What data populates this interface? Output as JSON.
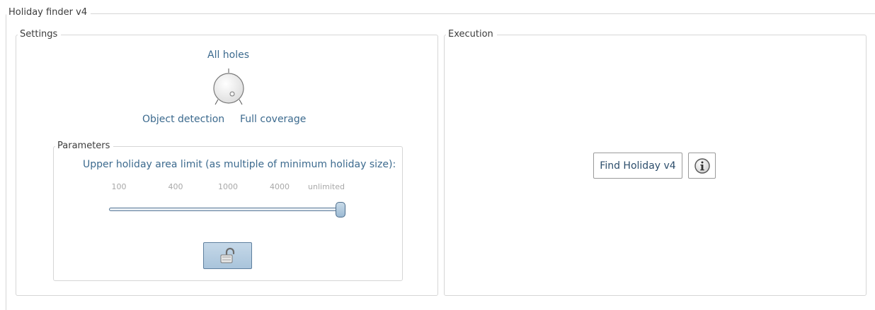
{
  "window": {
    "title": "Holiday finder v4"
  },
  "settings": {
    "legend": "Settings",
    "mode_knob": {
      "top_label": "All holes",
      "left_label": "Object detection",
      "right_label": "Full coverage"
    },
    "parameters": {
      "legend": "Parameters",
      "slider_label": "Upper holiday area limit (as multiple of minimum holiday size):",
      "ticks": [
        "100",
        "400",
        "1000",
        "4000",
        "unlimited"
      ],
      "selected_value": "unlimited",
      "lock_icon": "unlock-icon"
    }
  },
  "execution": {
    "legend": "Execution",
    "run_button": "Find Holiday v4",
    "info_icon": "info-icon"
  }
}
